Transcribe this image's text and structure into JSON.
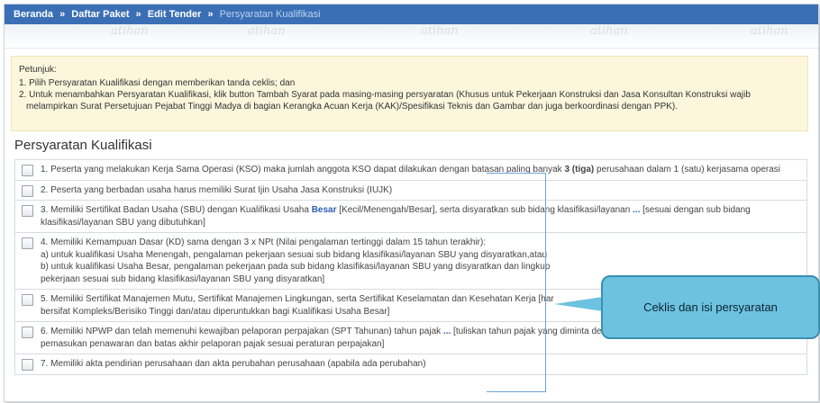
{
  "breadcrumb": {
    "home": "Beranda",
    "packages": "Daftar Paket",
    "edit": "Edit Tender",
    "current": "Persyaratan Kualifikasi",
    "separator": "»"
  },
  "watermark_text": "atihan",
  "hint": {
    "title": "Petunjuk:",
    "line1": "1. Pilih Persyaratan Kualifikasi dengan memberikan tanda ceklis; dan",
    "line2": "2. Untuk menambahkan Persyaratan Kualifikasi, klik button Tambah Syarat pada masing-masing persyaratan (Khusus untuk Pekerjaan Konstruksi dan Jasa Konsultan Konstruksi wajib",
    "line3": "melampirkan Surat Persetujuan Pejabat Tinggi Madya di bagian Kerangka Acuan Kerja (KAK)/Spesifikasi Teknis dan Gambar dan juga berkoordinasi dengan PPK)."
  },
  "section_title": "Persyaratan Kualifikasi",
  "items": {
    "i1": {
      "pre": "1. Peserta yang melakukan Kerja Sama Operasi (KSO) maka jumlah anggota KSO dapat dilakukan dengan batasan paling banyak ",
      "bold": "3 (tiga)",
      "post": " perusahaan dalam 1 (satu) kerjasama operasi"
    },
    "i2": "2. Peserta yang berbadan usaha harus memiliki Surat Ijin Usaha Jasa Konstruksi (IUJK)",
    "i3": {
      "pre": "3. Memiliki Sertifikat Badan Usaha (SBU) dengan Kualifikasi Usaha ",
      "value": "Besar",
      "mid": " [Kecil/Menengah/Besar], serta disyaratkan sub bidang klasifikasi/layanan ",
      "ellipsis": "...",
      "post": " [sesuai dengan sub bidang klasifikasi/layanan SBU yang dibutuhkan]"
    },
    "i4": {
      "line1": "4. Memiliki Kemampuan Dasar (KD) sama dengan 3 x NPt (Nilai pengalaman tertinggi dalam 15 tahun terakhir):",
      "line2": "a) untuk kualifikasi Usaha Menengah, pengalaman pekerjaan sesuai sub bidang klasifikasi/layanan SBU yang disyaratkan,atau",
      "line3": "b) untuk kualifikasi Usaha Besar, pengalaman pekerjaan pada sub bidang klasifikasi/layanan SBU yang disyaratkan dan lingkup",
      "line4": "pekerjaan sesuai sub bidang klasifikasi/layanan SBU yang disyaratkan]"
    },
    "i5": {
      "line1": "5. Memiliki Sertifikat Manajemen Mutu, Sertifikat Manajemen Lingkungan, serta Sertifikat Keselamatan dan Kesehatan Kerja [har",
      "line2": "bersifat Kompleks/Berisiko Tinggi dan/atau diperuntukkan bagi Kualifikasi Usaha Besar]"
    },
    "i6": {
      "pre": "6. Memiliki NPWP dan telah memenuhi kewajiban pelaporan perpajakan (SPT Tahunan) tahun pajak ",
      "ellipsis": "...",
      "post": " [tuliskan tahun pajak yang diminta dengan memperhatikan batas akhir",
      "line2": "pemasukan penawaran dan batas akhir pelaporan pajak sesuai peraturan perpajakan]"
    },
    "i7": "7. Memiliki akta pendirian perusahaan dan akta perubahan perusahaan (apabila ada perubahan)"
  },
  "callout": "Ceklis dan isi persyaratan",
  "colors": {
    "topbar": "#3b6fb5",
    "hint_bg": "#fbf6dc",
    "callout": "#6cc2df",
    "link": "#2b5db3"
  }
}
